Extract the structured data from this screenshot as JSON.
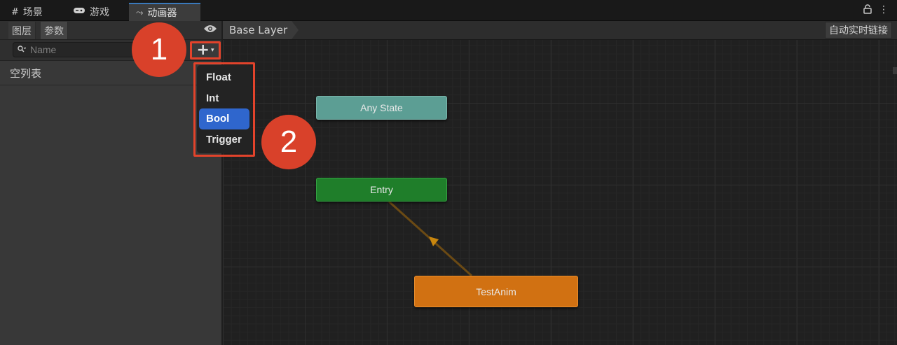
{
  "tabs": [
    {
      "icon": "#",
      "label": "场景"
    },
    {
      "icon": "🎮",
      "label": "游戏"
    },
    {
      "icon": "⤳",
      "label": "动画器"
    }
  ],
  "window_controls": {
    "lock": "🔓",
    "more": "⋮"
  },
  "left_panel": {
    "tabs": [
      "图层",
      "参数"
    ],
    "search": {
      "placeholder": "Name",
      "value": ""
    },
    "add_button": {
      "plus": "+",
      "caret": "▾"
    },
    "empty_label": "空列表"
  },
  "dropdown": {
    "items": [
      "Float",
      "Int",
      "Bool",
      "Trigger"
    ],
    "selected_index": 2
  },
  "callouts": [
    "1",
    "2"
  ],
  "graph": {
    "breadcrumb": "Base Layer",
    "live_link_label": "自动实时链接",
    "nodes": {
      "any_state": "Any State",
      "entry": "Entry",
      "default_state": "TestAnim"
    }
  },
  "colors": {
    "callout": "#d9412a",
    "highlight_outline": "#e2432b",
    "selected_item": "#2f66cd",
    "any_state": "#5c9e94",
    "entry": "#1f7e2a",
    "default_state": "#d17112",
    "transition": "#6b4a14"
  }
}
